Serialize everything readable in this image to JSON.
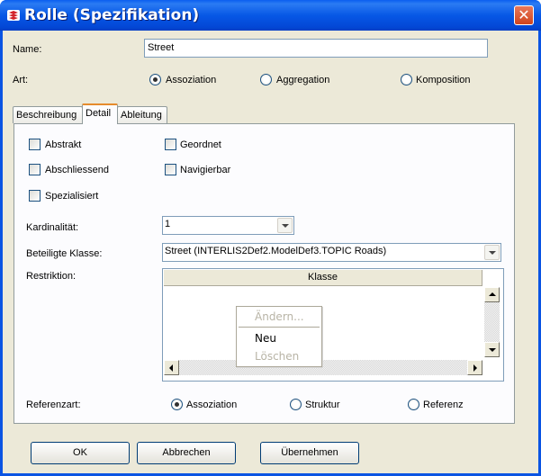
{
  "window": {
    "title": "Rolle (Spezifikation)",
    "close_label": "✕"
  },
  "name_field": {
    "label": "Name:",
    "value": "Street"
  },
  "art": {
    "label": "Art:",
    "options": [
      "Assoziation",
      "Aggregation",
      "Komposition"
    ],
    "selected": "Assoziation"
  },
  "tabs": [
    {
      "label": "Beschreibung"
    },
    {
      "label": "Detail",
      "active": true
    },
    {
      "label": "Ableitung"
    }
  ],
  "detail": {
    "checkboxes": {
      "abstrakt": "Abstrakt",
      "geordnet": "Geordnet",
      "abschliessend": "Abschliessend",
      "navigierbar": "Navigierbar",
      "spezialisiert": "Spezialisiert"
    },
    "kardinalitaet": {
      "label": "Kardinalität:",
      "value": "1"
    },
    "beteiligte_klasse": {
      "label": "Beteiligte Klasse:",
      "value": "Street (INTERLIS2Def2.ModelDef3.TOPIC Roads)"
    },
    "restriktion": {
      "label": "Restriktion:",
      "column_header": "Klasse"
    },
    "context_menu": {
      "items": [
        "Ändern...",
        "Neu",
        "Löschen"
      ],
      "disabled": [
        "Ändern...",
        "Löschen"
      ]
    },
    "referenzart": {
      "label": "Referenzart:",
      "options": [
        "Assoziation",
        "Struktur",
        "Referenz"
      ],
      "selected": "Assoziation"
    }
  },
  "buttons": {
    "ok": "OK",
    "cancel": "Abbrechen",
    "apply": "Übernehmen"
  }
}
